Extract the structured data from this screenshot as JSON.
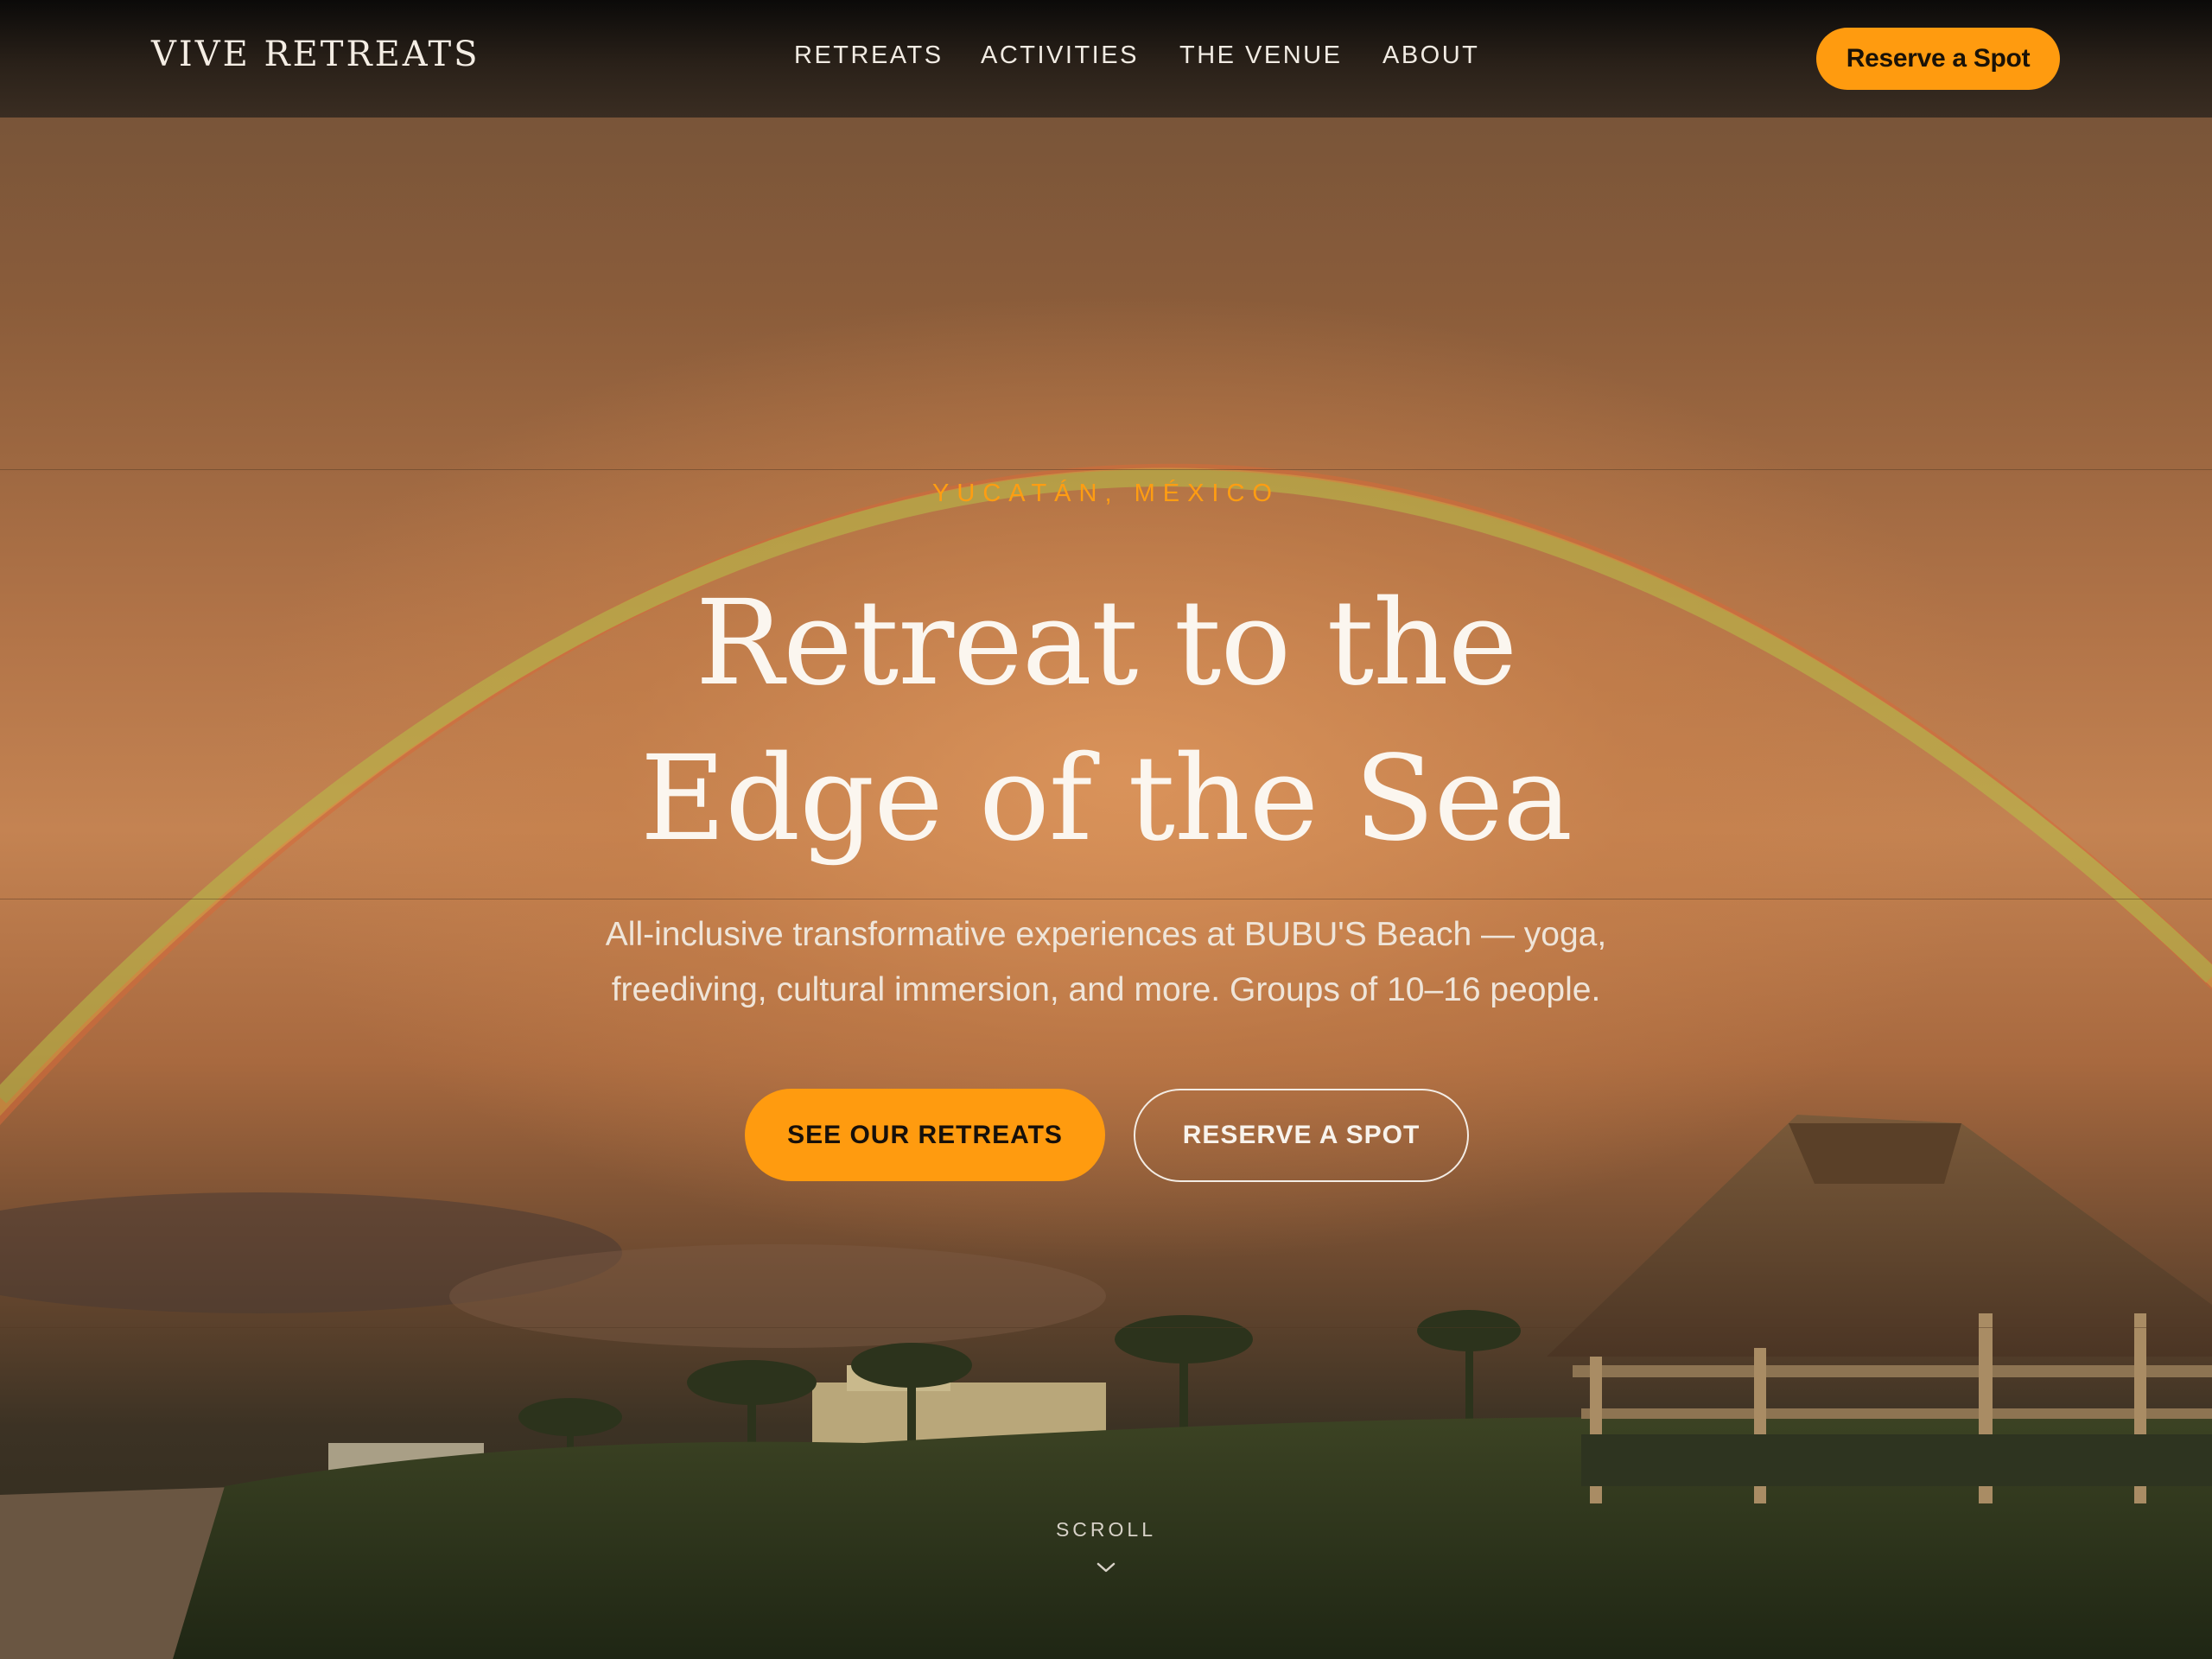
{
  "header": {
    "brand": "VIVE RETREATS",
    "nav": [
      {
        "label": "RETREATS"
      },
      {
        "label": "ACTIVITIES"
      },
      {
        "label": "THE VENUE"
      },
      {
        "label": "ABOUT"
      }
    ],
    "cta_label": "Reserve a Spot"
  },
  "hero": {
    "location": "YUCATÁN, MÉXICO",
    "title_line1": "Retreat to the",
    "title_line2": "Edge of the Sea",
    "subtitle_line1": "All-inclusive transformative experiences at BUBU'S Beach — yoga,",
    "subtitle_line2": "freediving, cultural immersion, and more. Groups of 10–16 people.",
    "primary_button": "SEE OUR RETREATS",
    "secondary_button": "RESERVE A SPOT",
    "scroll_label": "SCROLL"
  },
  "colors": {
    "accent": "#ff9b0f",
    "location_text": "#ff9d12",
    "header_bg": "#1c1612",
    "hero_tint": "#c48352"
  },
  "icons": {
    "scroll": "chevron-down-icon"
  }
}
